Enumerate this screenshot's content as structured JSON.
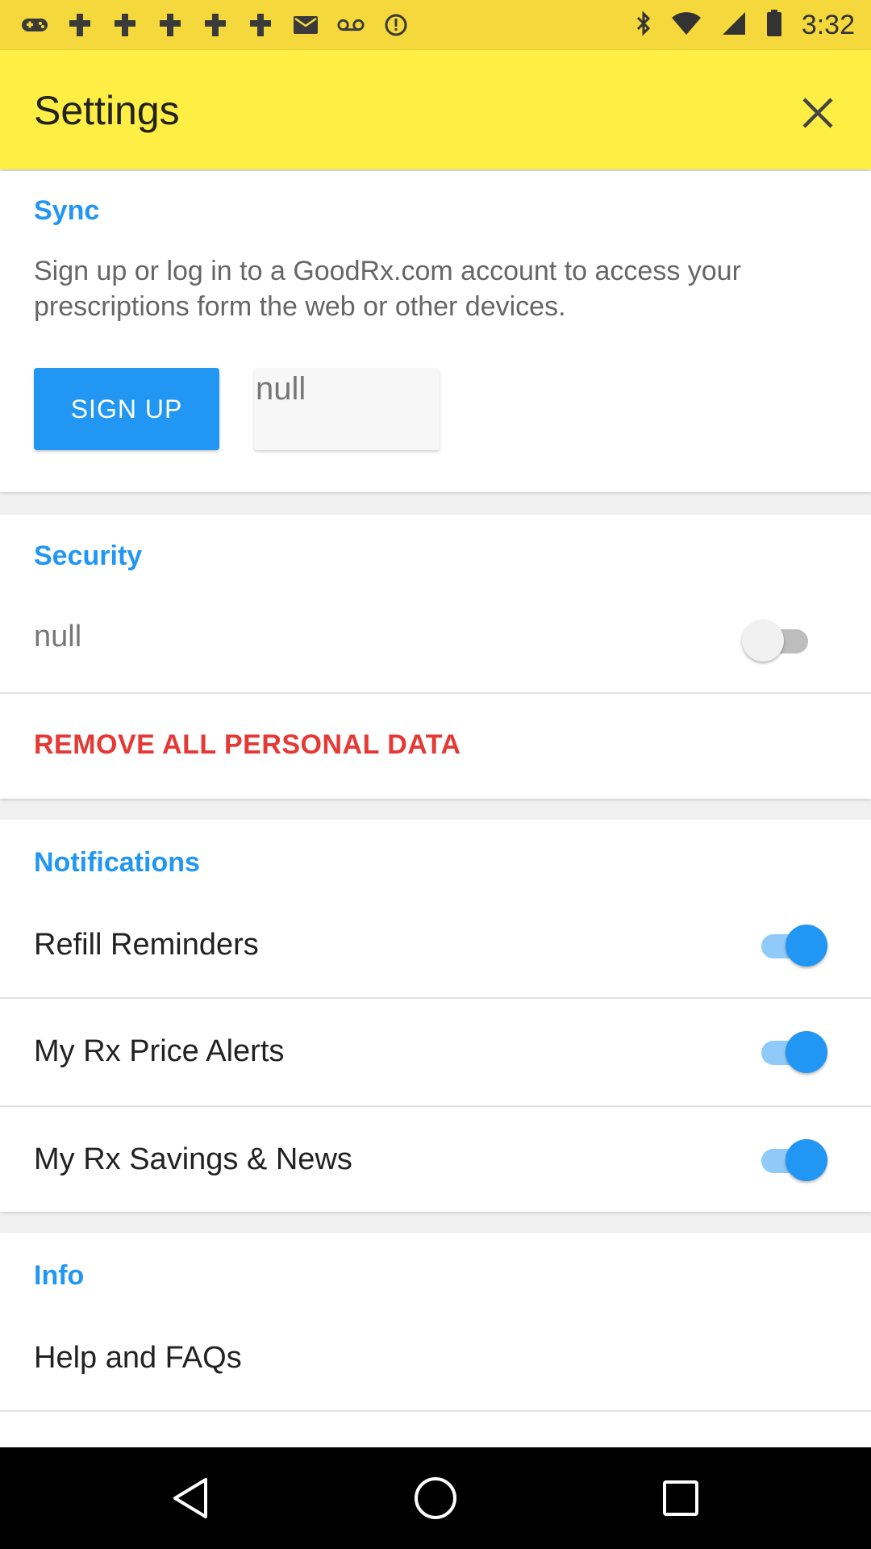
{
  "status_bar": {
    "time": "3:32",
    "left_icons": [
      "gamepad-icon",
      "cross-icon",
      "cross-icon",
      "cross-icon",
      "cross-icon",
      "cross-icon",
      "email-icon",
      "voicemail-icon",
      "alarm-icon"
    ],
    "right_icons": [
      "bluetooth-icon",
      "wifi-icon",
      "signal-icon",
      "battery-icon"
    ]
  },
  "header": {
    "title": "Settings",
    "close_icon": "close-icon"
  },
  "sync": {
    "title": "Sync",
    "description": "Sign up or log in to a GoodRx.com account to access your prescriptions form the web or other devices.",
    "signup_label": "SIGN UP",
    "second_button_label": "null"
  },
  "security": {
    "title": "Security",
    "row_label": "null",
    "row_toggle_on": false,
    "remove_label": "REMOVE ALL PERSONAL DATA"
  },
  "notifications": {
    "title": "Notifications",
    "items": [
      {
        "label": "Refill Reminders",
        "on": true
      },
      {
        "label": "My Rx Price Alerts",
        "on": true
      },
      {
        "label": "My Rx Savings & News",
        "on": true
      }
    ]
  },
  "info": {
    "title": "Info",
    "items": [
      {
        "label": "Help and FAQs"
      }
    ]
  },
  "nav_bar": {
    "icons": [
      "back-icon",
      "home-icon",
      "recents-icon"
    ]
  },
  "colors": {
    "accent": "#2196f3",
    "header_bg": "#ffee44",
    "status_bg": "#f5d93c",
    "danger": "#e53935"
  }
}
